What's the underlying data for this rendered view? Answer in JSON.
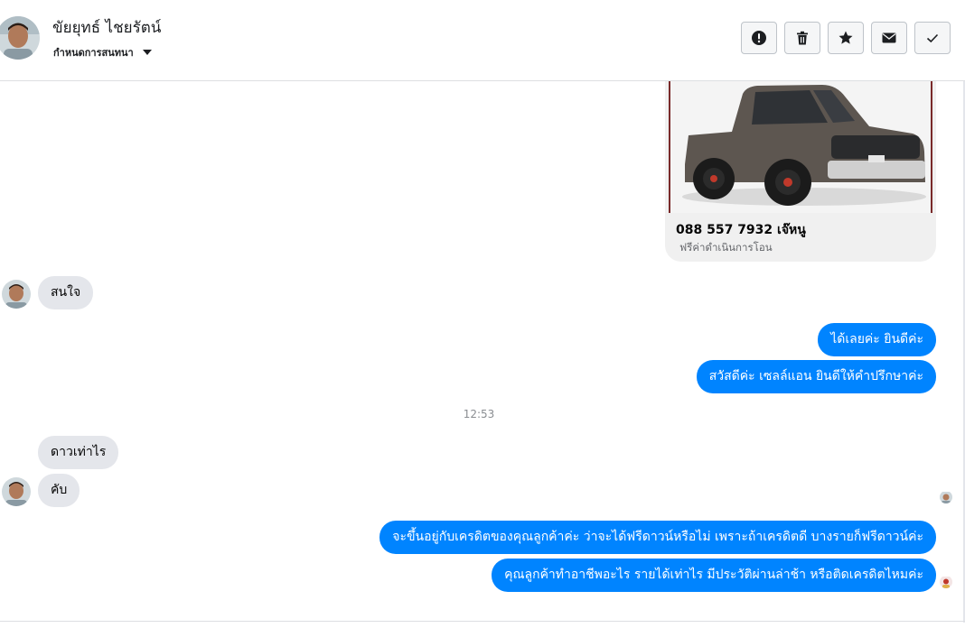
{
  "header": {
    "contact_name": "ขัยยุทธ์ ไชยรัตน์",
    "subtitle": "กำหนดการสนทนา",
    "actions": [
      {
        "name": "report",
        "icon": "exclamation-circle-icon"
      },
      {
        "name": "delete",
        "icon": "trash-icon"
      },
      {
        "name": "star",
        "icon": "star-icon"
      },
      {
        "name": "mark-unread",
        "icon": "envelope-icon"
      },
      {
        "name": "mark-done",
        "icon": "check-icon"
      }
    ]
  },
  "attachment": {
    "title": "088 557 7932 เจ๊หนู",
    "description": "ฟรีค่าดำเนินการโอน",
    "image": "gray-pickup-truck-photo"
  },
  "messages": [
    {
      "dir": "in",
      "text": "สนใจ"
    },
    {
      "dir": "out",
      "text": "ได้เลยค่ะ ยินดีค่ะ"
    },
    {
      "dir": "out",
      "text": "สวัสดีค่ะ เซลล์แอน ยินดีให้คำปรึกษาค่ะ"
    },
    {
      "dir": "in",
      "text": "ดาวเท่าไร"
    },
    {
      "dir": "in",
      "text": "คับ"
    },
    {
      "dir": "out",
      "text": "จะขึ้นอยู่กับเครดิตของคุณลูกค้าค่ะ ว่าจะได้ฟรีดาวน์หรือไม่ เพราะถ้าเครดิตดี บางรายก็ฟรีดาวน์ค่ะ"
    },
    {
      "dir": "out",
      "text": "คุณลูกค้าทำอาชีพอะไร รายได้เท่าไร มีประวัติผ่านล่าช้า หรือติดเครดิตไหมค่ะ"
    }
  ],
  "timestamp": "12:53",
  "colors": {
    "outgoing_bubble": "#0084ff",
    "incoming_bubble": "#e4e6eb",
    "border": "#dddfe2"
  }
}
